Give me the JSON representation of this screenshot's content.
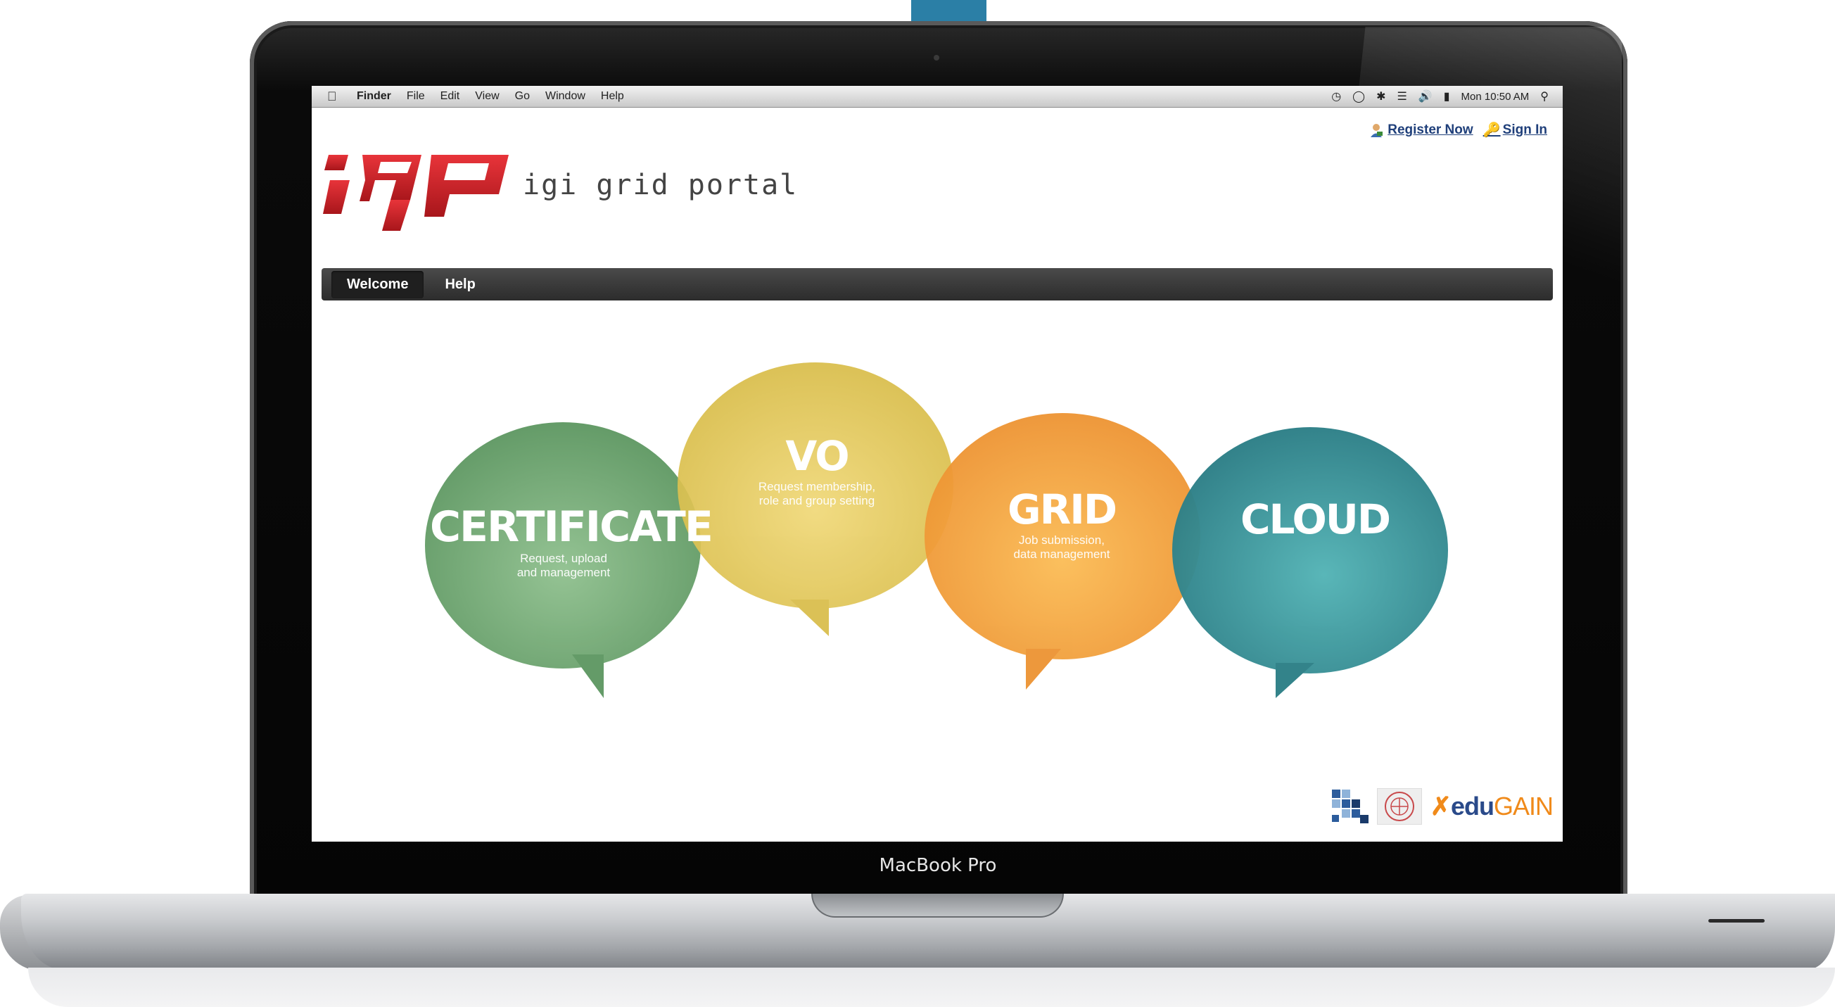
{
  "device": {
    "label": "MacBook Pro"
  },
  "menubar": {
    "app": "Finder",
    "items": [
      "File",
      "Edit",
      "View",
      "Go",
      "Window",
      "Help"
    ],
    "clock": "Mon 10:50 AM"
  },
  "portal": {
    "logo_text": "IGP",
    "subtitle": "igi grid portal",
    "account_links": {
      "register": "Register Now",
      "signin": "Sign In"
    },
    "nav": {
      "tabs": [
        {
          "label": "Welcome",
          "active": true
        },
        {
          "label": "Help",
          "active": false
        }
      ]
    },
    "bubbles": [
      {
        "title": "CERTIFICATE",
        "subtitle_line1": "Request, upload",
        "subtitle_line2": "and management",
        "color": "#6fa56f"
      },
      {
        "title": "VO",
        "subtitle_line1": "Request membership,",
        "subtitle_line2": "role and group setting",
        "color": "#e3c85a"
      },
      {
        "title": "GRID",
        "subtitle_line1": "Job submission,",
        "subtitle_line2": "data management",
        "color": "#f2a23e"
      },
      {
        "title": "CLOUD",
        "subtitle_line1": "",
        "subtitle_line2": "",
        "color": "#3a9aa0"
      }
    ],
    "footer_partners": {
      "edugain_edu": "edu",
      "edugain_gain": "GAIN"
    }
  },
  "colors": {
    "accent_tab": "#2b7fa6",
    "navbar": "#3a3a3a",
    "link": "#1f3f7a",
    "logo_red": "#d8262a"
  }
}
